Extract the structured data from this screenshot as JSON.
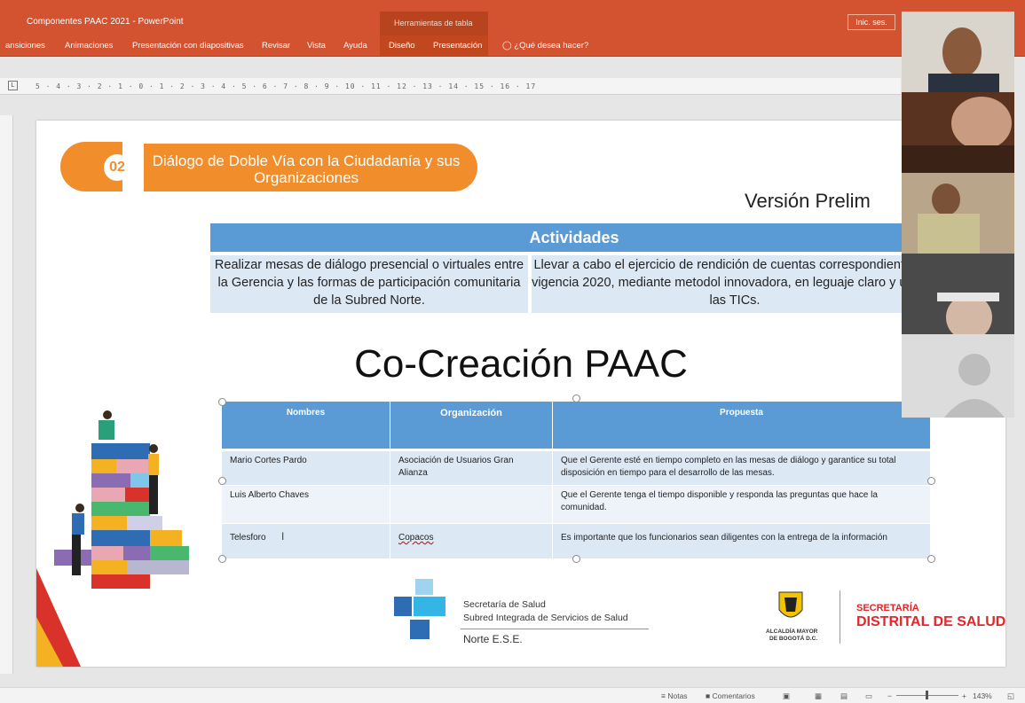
{
  "window": {
    "title": "Componentes PAAC 2021  -  PowerPoint",
    "context_group": "Herramientas de tabla",
    "signin": "Inic. ses."
  },
  "ribbon": {
    "tabs": [
      "ansiciones",
      "Animaciones",
      "Presentación con diapositivas",
      "Revisar",
      "Vista",
      "Ayuda",
      "Diseño",
      "Presentación"
    ],
    "tell_me": "¿Qué desea hacer?"
  },
  "ruler": {
    "marks": "5 · 4 · 3 · 2 · 1 · 0 · 1 · 2 · 3 · 4 · 5 · 6 · 7 · 8 · 9 · 10 · 11 · 12 · 13 · 14 · 15 · 16 · 17"
  },
  "slide": {
    "section_number": "02",
    "section_title": "Diálogo de Doble Vía con la Ciudadanía y sus Organizaciones",
    "version_label": "Versión Prelim",
    "activities_header": "Actividades",
    "activities": [
      "Realizar mesas de diálogo presencial o virtuales entre la Gerencia y las formas de participación comunitaria de la Subred Norte.",
      "Llevar a cabo el ejercicio de rendición de cuentas correspondiente a la vigencia 2020, mediante metodol innovadora, en leguaje claro y uso de las TICs."
    ],
    "main_title": "Co-Creación PAAC",
    "table": {
      "headers": [
        "Nombres",
        "Organización",
        "Propuesta"
      ],
      "rows": [
        [
          "Mario Cortes Pardo",
          "Asociación de Usuarios Gran Alianza",
          "Que el Gerente esté en tiempo completo en las mesas de diálogo y garantice su total disposición en tiempo para el desarrollo de las mesas."
        ],
        [
          "Luis Alberto Chaves",
          "",
          "Que el Gerente tenga el tiempo disponible y responda las preguntas que hace la comunidad."
        ],
        [
          "Telesforo",
          "Copacos",
          "Es importante que los funcionarios sean diligentes con la entrega de la información"
        ]
      ]
    },
    "logos": {
      "subred_line1": "Secretaría de Salud",
      "subred_line2": "Subred Integrada de Servicios de Salud",
      "subred_line3": "Norte E.S.E.",
      "alcaldia_line1": "ALCALDÍA MAYOR",
      "alcaldia_line2": "DE BOGOTÁ D.C.",
      "sds_line1": "SECRETARÍA",
      "sds_line2": "DISTRITAL DE SALUD"
    }
  },
  "statusbar": {
    "notes": "Notas",
    "comments": "Comentarios",
    "zoom": "143%"
  }
}
